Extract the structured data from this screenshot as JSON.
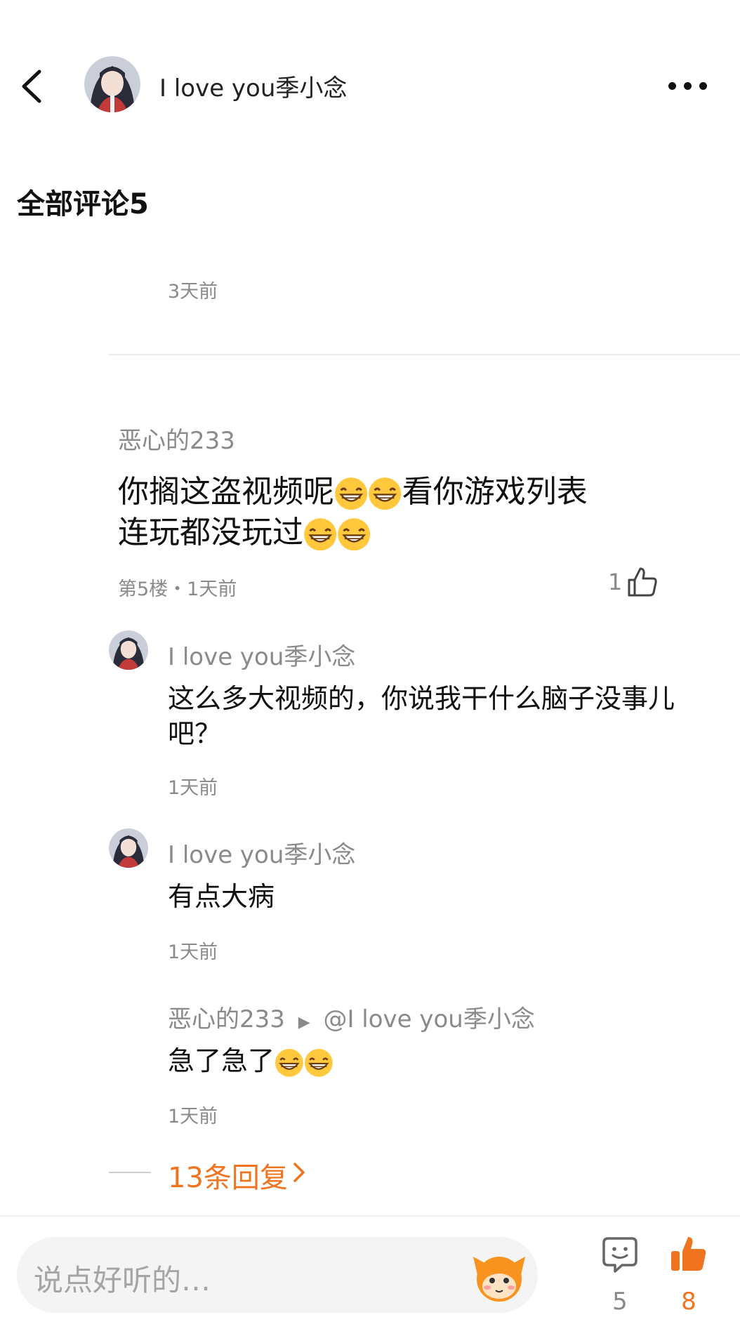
{
  "header": {
    "title": "I love you季小念"
  },
  "comments_header": "全部评论5",
  "prev_comment_time": "3天前",
  "main_comment": {
    "author": "恶心的233",
    "text_part1": "你搁这盗视频呢",
    "text_part2": "看你游戏列表",
    "text_part3": "连玩都没玩过",
    "meta": "第5楼・1天前",
    "likes": "1"
  },
  "replies": [
    {
      "author": "I love you季小念",
      "text": "这么多大视频的，你说我干什么脑子没事儿吧？",
      "time": "1天前"
    },
    {
      "author": "I love you季小念",
      "text": "有点大病",
      "time": "1天前"
    },
    {
      "author": "恶心的233",
      "reply_arrow": "▶",
      "reply_to": "@I love you季小念",
      "text": "急了急了",
      "time": "1天前"
    }
  ],
  "more_replies": "13条回复",
  "bottom_bar": {
    "input_placeholder": "说点好听的…",
    "comment_count": "5",
    "like_count": "8"
  },
  "colors": {
    "accent": "#f0741f",
    "muted": "#8a8a8a"
  }
}
